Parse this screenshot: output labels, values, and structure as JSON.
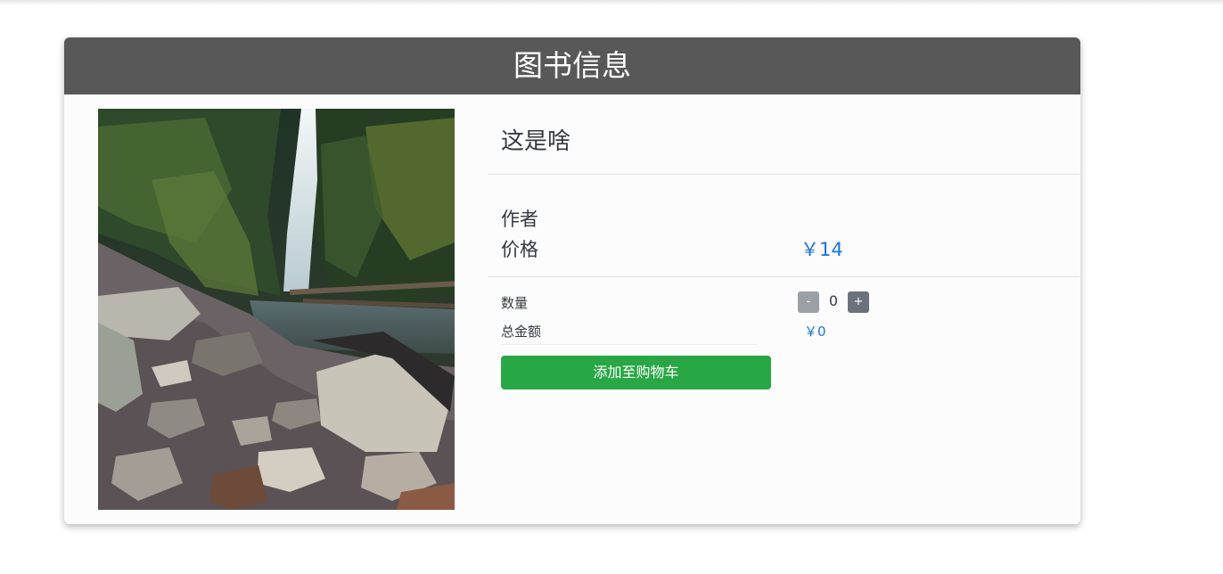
{
  "header": {
    "title": "图书信息"
  },
  "book": {
    "title": "这是啥",
    "author_label": "作者",
    "author_value": "",
    "price_label": "价格",
    "price_value": "￥14"
  },
  "order": {
    "quantity_label": "数量",
    "minus_label": "-",
    "quantity_value": "0",
    "plus_label": "+",
    "total_label": "总金额",
    "total_value": "￥0",
    "add_to_cart_label": "添加至购物车"
  },
  "image": {
    "name": "waterfall-photo",
    "description_icon": "waterfall-image"
  },
  "colors": {
    "header_bg": "#585858",
    "price": "#1a73e8",
    "add_button": "#28a745",
    "minus_button": "#9aa0a6",
    "plus_button": "#6c727c"
  }
}
